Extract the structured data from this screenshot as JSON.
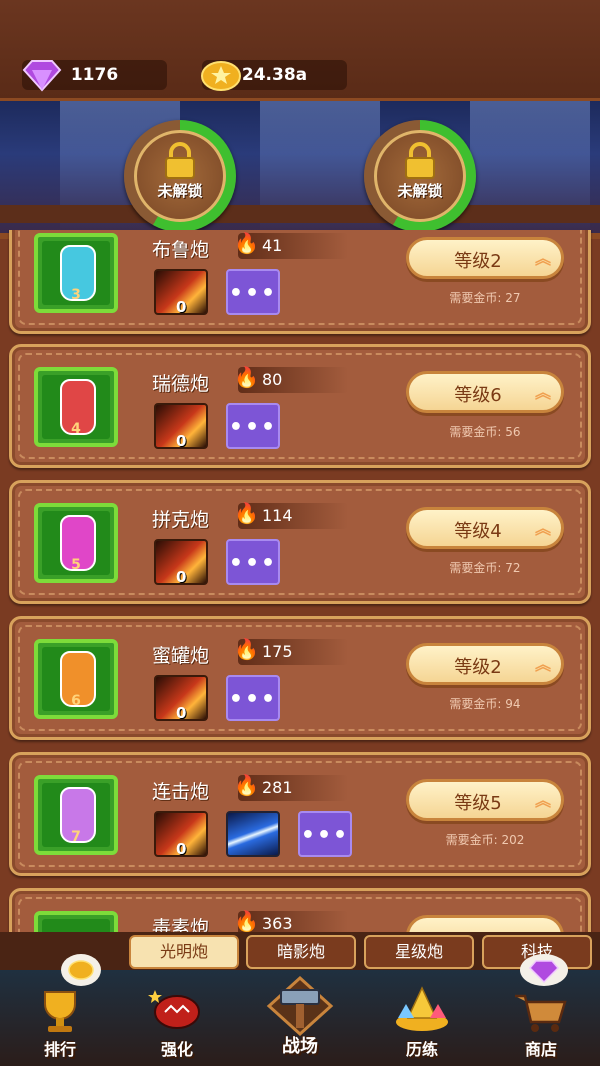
{
  "currency": {
    "gems": "1176",
    "gold": "24.38a"
  },
  "banner": {
    "slot1_label": "未解锁",
    "slot2_label": "未解锁"
  },
  "cannons": [
    {
      "name": "布鲁炮",
      "power": "41",
      "level": "等级2",
      "cost": "需要金币: 27",
      "badge": "3",
      "fire_level": "0",
      "color": "#46c8e0"
    },
    {
      "name": "瑞德炮",
      "power": "80",
      "level": "等级6",
      "cost": "需要金币: 56",
      "badge": "4",
      "fire_level": "0",
      "color": "#e04646"
    },
    {
      "name": "拼克炮",
      "power": "114",
      "level": "等级4",
      "cost": "需要金币: 72",
      "badge": "5",
      "fire_level": "0",
      "color": "#e046c8"
    },
    {
      "name": "蜜罐炮",
      "power": "175",
      "level": "等级2",
      "cost": "需要金币: 94",
      "badge": "6",
      "fire_level": "0",
      "color": "#f0902a"
    },
    {
      "name": "连击炮",
      "power": "281",
      "level": "等级5",
      "cost": "需要金币: 202",
      "badge": "7",
      "fire_level": "0",
      "color": "#c878e8"
    },
    {
      "name": "毒素炮",
      "power": "363"
    }
  ],
  "tabs": [
    "光明炮",
    "暗影炮",
    "星级炮",
    "科技"
  ],
  "nav": [
    "排行",
    "强化",
    "战场",
    "历练",
    "商店"
  ]
}
